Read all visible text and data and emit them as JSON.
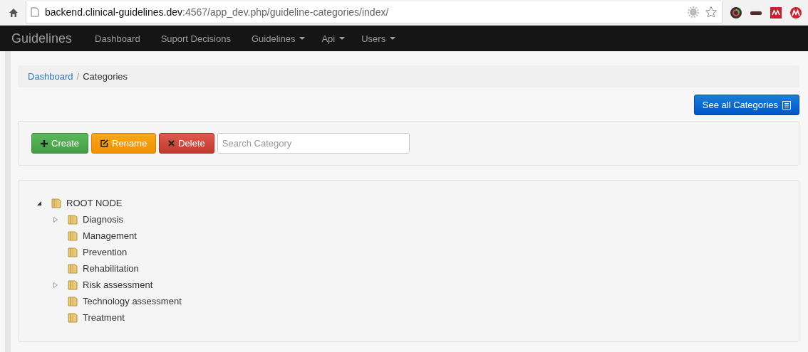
{
  "browser": {
    "url_host": "backend.clinical-guidelines.dev",
    "url_path": ":4567/app_dev.php/guideline-categories/index/"
  },
  "navbar": {
    "brand": "Guidelines",
    "items": [
      {
        "label": "Dashboard",
        "dropdown": false
      },
      {
        "label": "Suport Decisions",
        "dropdown": false
      },
      {
        "label": "Guidelines",
        "dropdown": true
      },
      {
        "label": "Api",
        "dropdown": true
      },
      {
        "label": "Users",
        "dropdown": true
      }
    ]
  },
  "breadcrumb_separator": "/",
  "breadcrumb": [
    {
      "label": "Dashboard",
      "kind": "link"
    },
    {
      "label": "Categories",
      "kind": "current"
    }
  ],
  "see_all_button": "See all Categories",
  "toolbar": {
    "buttons": [
      {
        "label": "Create",
        "kind": "create"
      },
      {
        "label": "Rename",
        "kind": "rename"
      },
      {
        "label": "Delete",
        "kind": "delete"
      }
    ],
    "search": {
      "placeholder": "Search Category"
    }
  },
  "tree": [
    {
      "label": "ROOT NODE",
      "kind": "open",
      "children": [
        {
          "label": "Diagnosis",
          "kind": "closed"
        },
        {
          "label": "Management",
          "kind": "leaf"
        },
        {
          "label": "Prevention",
          "kind": "leaf"
        },
        {
          "label": "Rehabilitation",
          "kind": "leaf"
        },
        {
          "label": "Risk assessment",
          "kind": "closed"
        },
        {
          "label": "Technology assessment",
          "kind": "leaf"
        },
        {
          "label": "Treatment",
          "kind": "leaf"
        }
      ]
    }
  ]
}
